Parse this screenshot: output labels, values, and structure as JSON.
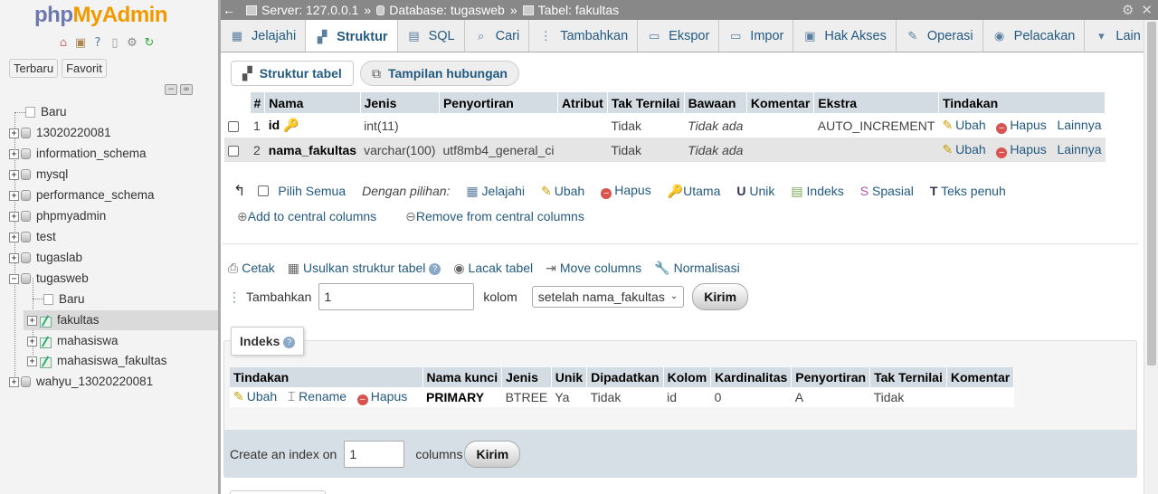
{
  "sidebar": {
    "logo": {
      "php": "php",
      "myadmin": "MyAdmin"
    },
    "nav_icons": [
      "home-icon",
      "exit-icon",
      "help-icon",
      "docs-icon",
      "settings-icon",
      "reload-icon"
    ],
    "tabs": [
      "Terbaru",
      "Favorit"
    ],
    "tree": [
      {
        "label": "Baru",
        "kind": "new"
      },
      {
        "label": "13020220081",
        "kind": "db"
      },
      {
        "label": "information_schema",
        "kind": "db"
      },
      {
        "label": "mysql",
        "kind": "db"
      },
      {
        "label": "performance_schema",
        "kind": "db"
      },
      {
        "label": "phpmyadmin",
        "kind": "db"
      },
      {
        "label": "test",
        "kind": "db"
      },
      {
        "label": "tugaslab",
        "kind": "db"
      },
      {
        "label": "tugasweb",
        "kind": "db-open"
      },
      {
        "label": "Baru",
        "kind": "new-child"
      },
      {
        "label": "fakultas",
        "kind": "table"
      },
      {
        "label": "mahasiswa",
        "kind": "table"
      },
      {
        "label": "mahasiswa_fakultas",
        "kind": "table"
      },
      {
        "label": "wahyu_13020220081",
        "kind": "db"
      }
    ]
  },
  "breadcrumb": {
    "server": "Server: 127.0.0.1",
    "database": "Database: tugasweb",
    "table": "Tabel: fakultas"
  },
  "tabs": [
    {
      "label": "Jelajahi",
      "icon": "browse-icon",
      "glyph": "▦"
    },
    {
      "label": "Struktur",
      "icon": "structure-icon",
      "glyph": "▞",
      "active": true
    },
    {
      "label": "SQL",
      "icon": "sql-icon",
      "glyph": "▤"
    },
    {
      "label": "Cari",
      "icon": "search-icon",
      "glyph": "⌕"
    },
    {
      "label": "Tambahkan",
      "icon": "insert-icon",
      "glyph": "⋮"
    },
    {
      "label": "Ekspor",
      "icon": "export-icon",
      "glyph": "▭"
    },
    {
      "label": "Impor",
      "icon": "import-icon",
      "glyph": "▭"
    },
    {
      "label": "Hak Akses",
      "icon": "privileges-icon",
      "glyph": "▣"
    },
    {
      "label": "Operasi",
      "icon": "operations-icon",
      "glyph": "✎"
    },
    {
      "label": "Pelacakan",
      "icon": "tracking-icon",
      "glyph": "◉"
    },
    {
      "label": "Lain",
      "icon": "more-icon",
      "glyph": "▾"
    }
  ],
  "subtabs": {
    "structure": "Struktur tabel",
    "relation": "Tampilan hubungan"
  },
  "structure": {
    "headers": [
      "#",
      "Nama",
      "Jenis",
      "Penyortiran",
      "Atribut",
      "Tak Ternilai",
      "Bawaan",
      "Komentar",
      "Ekstra",
      "Tindakan"
    ],
    "rows": [
      {
        "no": "1",
        "name": "id",
        "type": "int(11)",
        "collation": "",
        "attr": "",
        "null": "Tidak",
        "default": "Tidak ada",
        "comment": "",
        "extra": "AUTO_INCREMENT"
      },
      {
        "no": "2",
        "name": "nama_fakultas",
        "type": "varchar(100)",
        "collation": "utf8mb4_general_ci",
        "attr": "",
        "null": "Tidak",
        "default": "Tidak ada",
        "comment": "",
        "extra": ""
      }
    ],
    "actions": {
      "edit": "Ubah",
      "drop": "Hapus",
      "more": "Lainnya"
    }
  },
  "bulk": {
    "check_all": "Pilih Semua",
    "with_selected": "Dengan pilihan:",
    "browse": "Jelajahi",
    "edit": "Ubah",
    "drop": "Hapus",
    "primary": "Utama",
    "unique": "Unik",
    "index": "Indeks",
    "spatial": "Spasial",
    "fulltext": "Teks penuh",
    "add_central": "Add to central columns",
    "remove_central": "Remove from central columns"
  },
  "tools": {
    "print": "Cetak",
    "propose": "Usulkan struktur tabel",
    "track": "Lacak tabel",
    "move": "Move columns",
    "normalize": "Normalisasi"
  },
  "add_columns": {
    "label": "Tambahkan",
    "count": "1",
    "unit": "kolom",
    "position": "setelah nama_fakultas",
    "submit": "Kirim"
  },
  "indexes": {
    "title": "Indeks",
    "headers": [
      "Tindakan",
      "Nama kunci",
      "Jenis",
      "Unik",
      "Dipadatkan",
      "Kolom",
      "Kardinalitas",
      "Penyortiran",
      "Tak Ternilai",
      "Komentar"
    ],
    "row": {
      "edit": "Ubah",
      "rename": "Rename",
      "drop": "Hapus",
      "key": "PRIMARY",
      "type": "BTREE",
      "unique": "Ya",
      "packed": "Tidak",
      "column": "id",
      "cardinality": "0",
      "collation": "A",
      "null": "Tidak",
      "comment": ""
    },
    "create_label": "Create an index on",
    "create_count": "1",
    "create_unit": "columns",
    "create_submit": "Kirim"
  }
}
